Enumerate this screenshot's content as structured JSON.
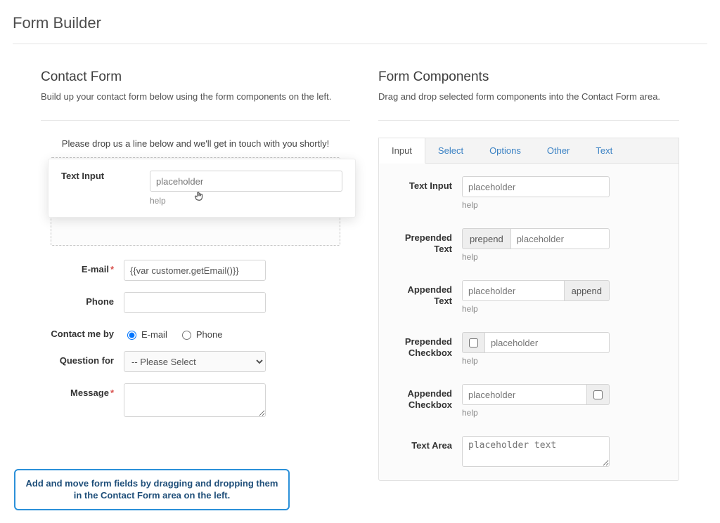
{
  "page": {
    "title": "Form Builder"
  },
  "left": {
    "title": "Contact Form",
    "desc": "Build up your contact form below using the form components on the left.",
    "drop_intro": "Please drop us a line below and we'll get in touch with you shortly!",
    "dragging": {
      "label": "Text Input",
      "placeholder": "placeholder",
      "help": "help"
    },
    "fields": {
      "email": {
        "label": "E-mail",
        "value": "{{var customer.getEmail()}}",
        "required": true
      },
      "phone": {
        "label": "Phone",
        "value": ""
      },
      "contact_by": {
        "label": "Contact me by",
        "options": [
          "E-mail",
          "Phone"
        ],
        "selected": "E-mail"
      },
      "question_for": {
        "label": "Question for",
        "placeholder": "-- Please Select"
      },
      "message": {
        "label": "Message",
        "required": true,
        "value": ""
      }
    }
  },
  "right": {
    "title": "Form Components",
    "desc": "Drag and drop selected form components into the Contact Form area.",
    "tabs": [
      "Input",
      "Select",
      "Options",
      "Other",
      "Text"
    ],
    "active_tab": "Input",
    "components": {
      "text_input": {
        "label": "Text Input",
        "placeholder": "placeholder",
        "help": "help"
      },
      "prepended_text": {
        "label": "Prepended Text",
        "prepend": "prepend",
        "placeholder": "placeholder",
        "help": "help"
      },
      "appended_text": {
        "label": "Appended Text",
        "append": "append",
        "placeholder": "placeholder",
        "help": "help"
      },
      "prepended_checkbox": {
        "label": "Prepended Checkbox",
        "placeholder": "placeholder",
        "help": "help"
      },
      "appended_checkbox": {
        "label": "Appended Checkbox",
        "placeholder": "placeholder",
        "help": "help"
      },
      "text_area": {
        "label": "Text Area",
        "placeholder": "placeholder text"
      }
    }
  },
  "callout": "Add and move form fields by dragging and dropping them in the Contact Form area on the left."
}
